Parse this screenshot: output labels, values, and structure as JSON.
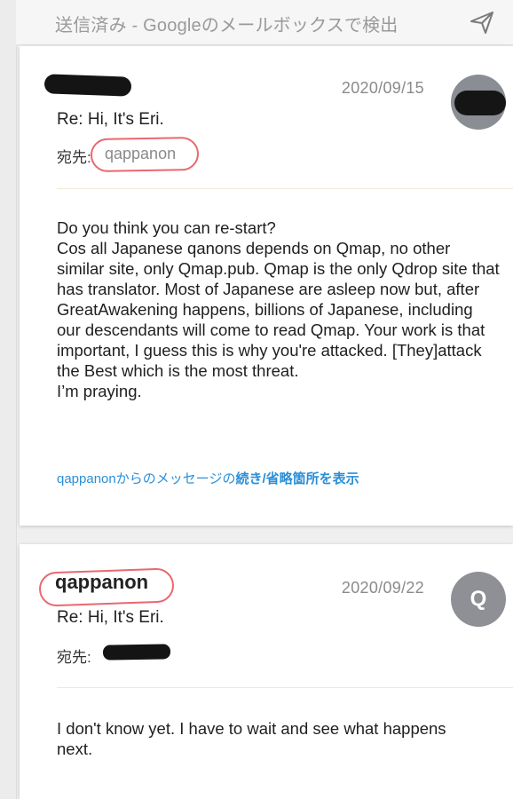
{
  "header": {
    "search_text": "送信済み - Googleのメールボックスで検出",
    "send_icon": "send-icon"
  },
  "messages": [
    {
      "sender": "",
      "date": "2020/09/15",
      "subject": "Re: Hi, It's Eri.",
      "to_label": "宛先:",
      "to_value": "qappanon",
      "body": [
        "Do you think you can re-start?",
        "Cos all Japanese qanons depends on Qmap, no other similar site, only Qmap.pub. Qmap is the only Qdrop site that has translator. Most of Japanese are asleep now but, after GreatAwakening happens, billions of Japanese, including our descendants will come to read Qmap. Your work is that important, I guess this is why you're attacked. [They]attack the Best which is the most threat.",
        "I’m praying."
      ],
      "show_more_prefix": "qappanonからのメッセージの",
      "show_more_link": "続き/省略箇所を表示"
    },
    {
      "sender": "qappanon",
      "date": "2020/09/22",
      "avatar_letter": "Q",
      "subject": "Re: Hi, It's Eri.",
      "to_label": "宛先:",
      "to_value": "",
      "body": [
        "I don't know yet.  I have to wait and see what happens next."
      ]
    }
  ],
  "colors": {
    "link": "#2b8fd8",
    "annotation_circle": "#e9686e",
    "avatar": "#8e9096"
  }
}
